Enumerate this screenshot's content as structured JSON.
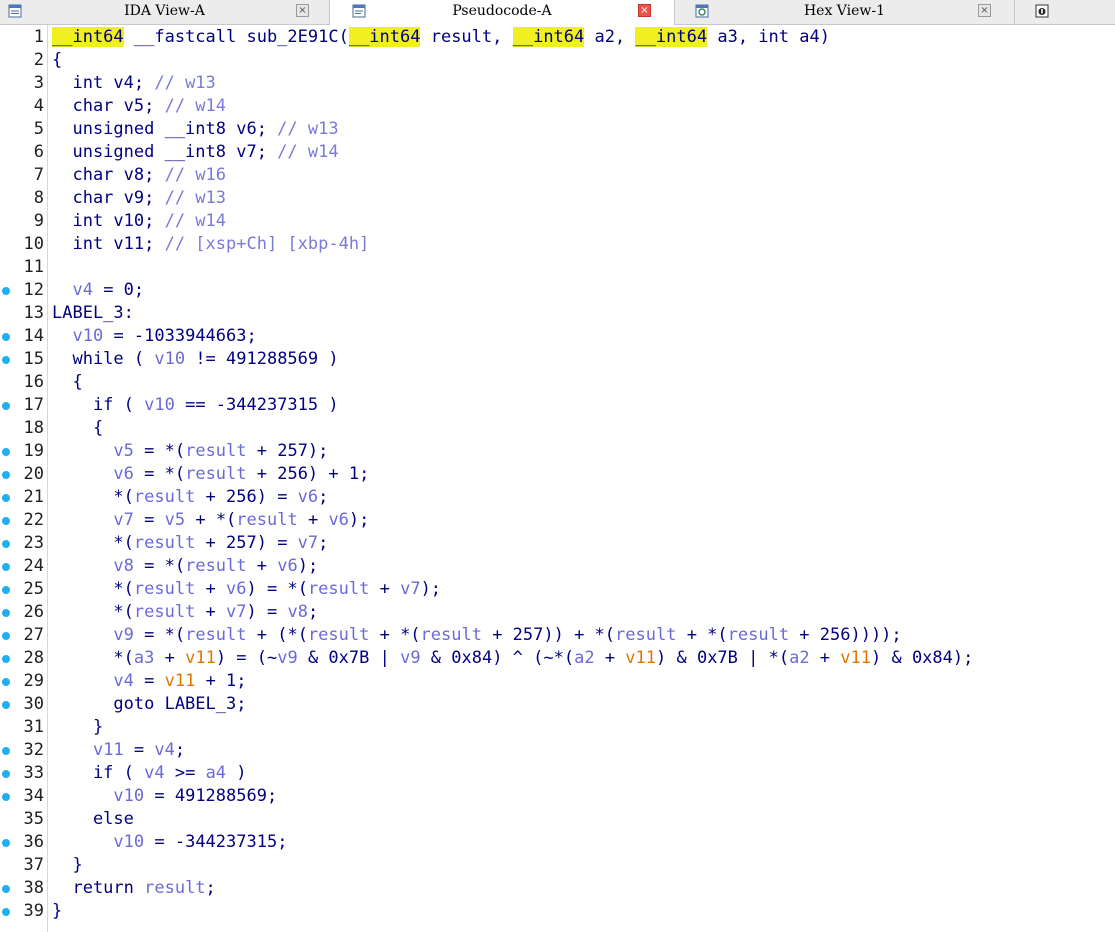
{
  "tabs": [
    {
      "label": "IDA View-A",
      "close": "×",
      "active": false
    },
    {
      "label": "Pseudocode-A",
      "close": "×",
      "active": true
    },
    {
      "label": "Hex View-1",
      "close": "×",
      "active": false
    }
  ],
  "code": [
    {
      "n": "1",
      "bp": false,
      "parts": [
        {
          "c": "cursor"
        },
        {
          "t": "__int64",
          "c": "hl"
        },
        {
          "t": " __fastcall sub_2E91C("
        },
        {
          "t": "__int64",
          "c": "hl"
        },
        {
          "t": " result, "
        },
        {
          "t": "__int64",
          "c": "hl"
        },
        {
          "t": " a2, "
        },
        {
          "t": "__int64",
          "c": "hl"
        },
        {
          "t": " a3, int a4)"
        }
      ]
    },
    {
      "n": "2",
      "bp": false,
      "parts": [
        {
          "t": "{"
        }
      ]
    },
    {
      "n": "3",
      "bp": false,
      "parts": [
        {
          "t": "  int v4; "
        },
        {
          "t": "// w13",
          "c": "cmt"
        }
      ]
    },
    {
      "n": "4",
      "bp": false,
      "parts": [
        {
          "t": "  char v5; "
        },
        {
          "t": "// w14",
          "c": "cmt"
        }
      ]
    },
    {
      "n": "5",
      "bp": false,
      "parts": [
        {
          "t": "  unsigned __int8 v6; "
        },
        {
          "t": "// w13",
          "c": "cmt"
        }
      ]
    },
    {
      "n": "6",
      "bp": false,
      "parts": [
        {
          "t": "  unsigned __int8 v7; "
        },
        {
          "t": "// w14",
          "c": "cmt"
        }
      ]
    },
    {
      "n": "7",
      "bp": false,
      "parts": [
        {
          "t": "  char v8; "
        },
        {
          "t": "// w16",
          "c": "cmt"
        }
      ]
    },
    {
      "n": "8",
      "bp": false,
      "parts": [
        {
          "t": "  char v9; "
        },
        {
          "t": "// w13",
          "c": "cmt"
        }
      ]
    },
    {
      "n": "9",
      "bp": false,
      "parts": [
        {
          "t": "  int v10; "
        },
        {
          "t": "// w14",
          "c": "cmt"
        }
      ]
    },
    {
      "n": "10",
      "bp": false,
      "parts": [
        {
          "t": "  int v11; "
        },
        {
          "t": "// [xsp+Ch] [xbp-4h]",
          "c": "cmt"
        }
      ]
    },
    {
      "n": "11",
      "bp": false,
      "parts": [
        {
          "t": ""
        }
      ]
    },
    {
      "n": "12",
      "bp": true,
      "parts": [
        {
          "t": "  "
        },
        {
          "t": "v4",
          "c": "var"
        },
        {
          "t": " = 0;"
        }
      ]
    },
    {
      "n": "13",
      "bp": false,
      "parts": [
        {
          "t": "LABEL_3:"
        }
      ]
    },
    {
      "n": "14",
      "bp": true,
      "parts": [
        {
          "t": "  "
        },
        {
          "t": "v10",
          "c": "var"
        },
        {
          "t": " = -1033944663;"
        }
      ]
    },
    {
      "n": "15",
      "bp": true,
      "parts": [
        {
          "t": "  while ( "
        },
        {
          "t": "v10",
          "c": "var"
        },
        {
          "t": " != 491288569 )"
        }
      ]
    },
    {
      "n": "16",
      "bp": false,
      "parts": [
        {
          "t": "  {"
        }
      ]
    },
    {
      "n": "17",
      "bp": true,
      "parts": [
        {
          "t": "    if ( "
        },
        {
          "t": "v10",
          "c": "var"
        },
        {
          "t": " == -344237315 )"
        }
      ]
    },
    {
      "n": "18",
      "bp": false,
      "parts": [
        {
          "t": "    {"
        }
      ]
    },
    {
      "n": "19",
      "bp": true,
      "parts": [
        {
          "t": "      "
        },
        {
          "t": "v5",
          "c": "var"
        },
        {
          "t": " = *("
        },
        {
          "t": "result",
          "c": "var"
        },
        {
          "t": " + 257);"
        }
      ]
    },
    {
      "n": "20",
      "bp": true,
      "parts": [
        {
          "t": "      "
        },
        {
          "t": "v6",
          "c": "var"
        },
        {
          "t": " = *("
        },
        {
          "t": "result",
          "c": "var"
        },
        {
          "t": " + 256) + 1;"
        }
      ]
    },
    {
      "n": "21",
      "bp": true,
      "parts": [
        {
          "t": "      *("
        },
        {
          "t": "result",
          "c": "var"
        },
        {
          "t": " + 256) = "
        },
        {
          "t": "v6",
          "c": "var"
        },
        {
          "t": ";"
        }
      ]
    },
    {
      "n": "22",
      "bp": true,
      "parts": [
        {
          "t": "      "
        },
        {
          "t": "v7",
          "c": "var"
        },
        {
          "t": " = "
        },
        {
          "t": "v5",
          "c": "var"
        },
        {
          "t": " + *("
        },
        {
          "t": "result",
          "c": "var"
        },
        {
          "t": " + "
        },
        {
          "t": "v6",
          "c": "var"
        },
        {
          "t": ");"
        }
      ]
    },
    {
      "n": "23",
      "bp": true,
      "parts": [
        {
          "t": "      *("
        },
        {
          "t": "result",
          "c": "var"
        },
        {
          "t": " + 257) = "
        },
        {
          "t": "v7",
          "c": "var"
        },
        {
          "t": ";"
        }
      ]
    },
    {
      "n": "24",
      "bp": true,
      "parts": [
        {
          "t": "      "
        },
        {
          "t": "v8",
          "c": "var"
        },
        {
          "t": " = *("
        },
        {
          "t": "result",
          "c": "var"
        },
        {
          "t": " + "
        },
        {
          "t": "v6",
          "c": "var"
        },
        {
          "t": ");"
        }
      ]
    },
    {
      "n": "25",
      "bp": true,
      "parts": [
        {
          "t": "      *("
        },
        {
          "t": "result",
          "c": "var"
        },
        {
          "t": " + "
        },
        {
          "t": "v6",
          "c": "var"
        },
        {
          "t": ") = *("
        },
        {
          "t": "result",
          "c": "var"
        },
        {
          "t": " + "
        },
        {
          "t": "v7",
          "c": "var"
        },
        {
          "t": ");"
        }
      ]
    },
    {
      "n": "26",
      "bp": true,
      "parts": [
        {
          "t": "      *("
        },
        {
          "t": "result",
          "c": "var"
        },
        {
          "t": " + "
        },
        {
          "t": "v7",
          "c": "var"
        },
        {
          "t": ") = "
        },
        {
          "t": "v8",
          "c": "var"
        },
        {
          "t": ";"
        }
      ]
    },
    {
      "n": "27",
      "bp": true,
      "parts": [
        {
          "t": "      "
        },
        {
          "t": "v9",
          "c": "var"
        },
        {
          "t": " = *("
        },
        {
          "t": "result",
          "c": "var"
        },
        {
          "t": " + (*("
        },
        {
          "t": "result",
          "c": "var"
        },
        {
          "t": " + *("
        },
        {
          "t": "result",
          "c": "var"
        },
        {
          "t": " + 257)) + *("
        },
        {
          "t": "result",
          "c": "var"
        },
        {
          "t": " + *("
        },
        {
          "t": "result",
          "c": "var"
        },
        {
          "t": " + 256))));"
        }
      ]
    },
    {
      "n": "28",
      "bp": true,
      "parts": [
        {
          "t": "      *("
        },
        {
          "t": "a3",
          "c": "var"
        },
        {
          "t": " + "
        },
        {
          "t": "v11",
          "c": "gvar"
        },
        {
          "t": ") = (~"
        },
        {
          "t": "v9",
          "c": "var"
        },
        {
          "t": " & 0x7B | "
        },
        {
          "t": "v9",
          "c": "var"
        },
        {
          "t": " & 0x84) ^ (~*("
        },
        {
          "t": "a2",
          "c": "var"
        },
        {
          "t": " + "
        },
        {
          "t": "v11",
          "c": "gvar"
        },
        {
          "t": ") & 0x7B | *("
        },
        {
          "t": "a2",
          "c": "var"
        },
        {
          "t": " + "
        },
        {
          "t": "v11",
          "c": "gvar"
        },
        {
          "t": ") & 0x84);"
        }
      ]
    },
    {
      "n": "29",
      "bp": true,
      "parts": [
        {
          "t": "      "
        },
        {
          "t": "v4",
          "c": "var"
        },
        {
          "t": " = "
        },
        {
          "t": "v11",
          "c": "gvar"
        },
        {
          "t": " + 1;"
        }
      ]
    },
    {
      "n": "30",
      "bp": true,
      "parts": [
        {
          "t": "      goto LABEL_3;"
        }
      ]
    },
    {
      "n": "31",
      "bp": false,
      "parts": [
        {
          "t": "    }"
        }
      ]
    },
    {
      "n": "32",
      "bp": true,
      "parts": [
        {
          "t": "    "
        },
        {
          "t": "v11",
          "c": "var"
        },
        {
          "t": " = "
        },
        {
          "t": "v4",
          "c": "var"
        },
        {
          "t": ";"
        }
      ]
    },
    {
      "n": "33",
      "bp": true,
      "parts": [
        {
          "t": "    if ( "
        },
        {
          "t": "v4",
          "c": "var"
        },
        {
          "t": " >= "
        },
        {
          "t": "a4",
          "c": "var"
        },
        {
          "t": " )"
        }
      ]
    },
    {
      "n": "34",
      "bp": true,
      "parts": [
        {
          "t": "      "
        },
        {
          "t": "v10",
          "c": "var"
        },
        {
          "t": " = 491288569;"
        }
      ]
    },
    {
      "n": "35",
      "bp": false,
      "parts": [
        {
          "t": "    else"
        }
      ]
    },
    {
      "n": "36",
      "bp": true,
      "parts": [
        {
          "t": "      "
        },
        {
          "t": "v10",
          "c": "var"
        },
        {
          "t": " = -344237315;"
        }
      ]
    },
    {
      "n": "37",
      "bp": false,
      "parts": [
        {
          "t": "  }"
        }
      ]
    },
    {
      "n": "38",
      "bp": true,
      "parts": [
        {
          "t": "  return "
        },
        {
          "t": "result",
          "c": "var"
        },
        {
          "t": ";"
        }
      ]
    },
    {
      "n": "39",
      "bp": true,
      "parts": [
        {
          "t": "}"
        }
      ]
    }
  ]
}
